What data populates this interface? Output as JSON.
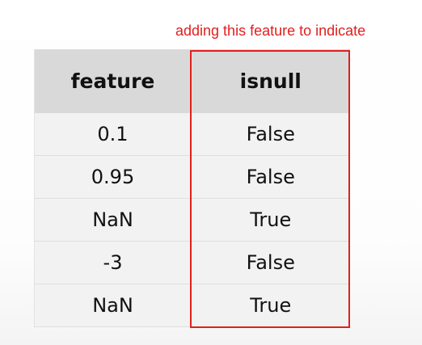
{
  "annotation": {
    "text": "adding this feature to indicate",
    "color": "#e0201f"
  },
  "table": {
    "headers": [
      "feature",
      "isnull"
    ],
    "rows": [
      [
        "0.1",
        "False"
      ],
      [
        "0.95",
        "False"
      ],
      [
        "NaN",
        "True"
      ],
      [
        "-3",
        "False"
      ],
      [
        "NaN",
        "True"
      ]
    ]
  },
  "colors": {
    "header_bg": "#d9d9d9",
    "cell_bg": "#f2f2f2",
    "highlight_border": "#e0201f"
  }
}
